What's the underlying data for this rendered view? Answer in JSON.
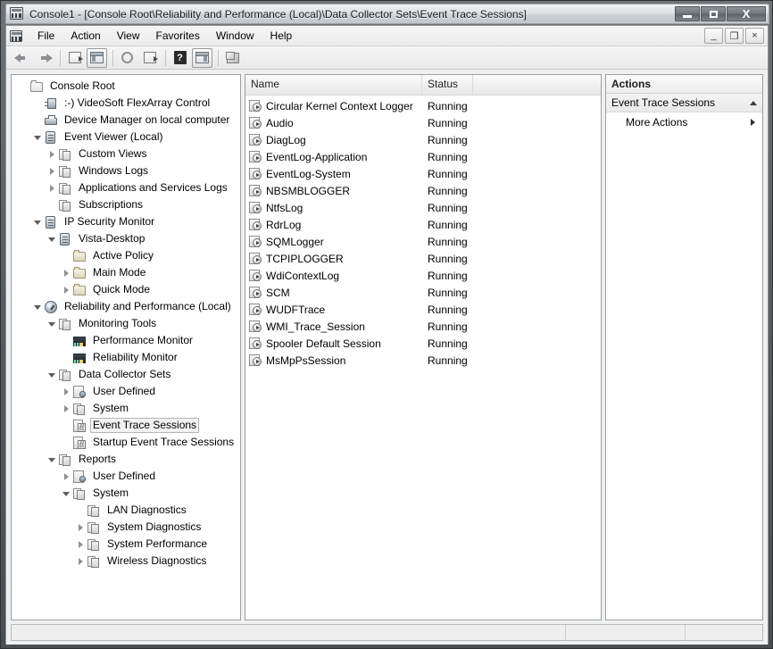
{
  "window": {
    "title": "Console1 - [Console Root\\Reliability and Performance (Local)\\Data Collector Sets\\Event Trace Sessions]",
    "title_icon": "mmc-console-icon",
    "buttons": {
      "minimize": "minimize-button",
      "maximize": "maximize-button",
      "close_label": "X"
    },
    "mdi_buttons": {
      "minimize_label": "_",
      "restore_label": "❐",
      "close_label": "×"
    }
  },
  "menu": {
    "items": [
      {
        "label": "File"
      },
      {
        "label": "Action"
      },
      {
        "label": "View"
      },
      {
        "label": "Favorites"
      },
      {
        "label": "Window"
      },
      {
        "label": "Help"
      }
    ]
  },
  "toolbar": {
    "buttons": [
      {
        "name": "back-button",
        "icon": "arrow-left-icon"
      },
      {
        "name": "forward-button",
        "icon": "arrow-right-icon"
      },
      {
        "name": "up-one-level-button",
        "icon": "folder-up-icon"
      },
      {
        "name": "show-hide-console-tree-button",
        "icon": "console-tree-icon"
      },
      {
        "name": "refresh-button",
        "icon": "refresh-icon"
      },
      {
        "name": "export-list-button",
        "icon": "export-list-icon"
      },
      {
        "name": "help-button",
        "icon": "help-icon"
      },
      {
        "name": "show-hide-action-pane-button",
        "icon": "action-pane-icon"
      },
      {
        "name": "new-window-button",
        "icon": "new-window-icon"
      }
    ]
  },
  "tree": {
    "items": [
      {
        "label": "Console Root",
        "depth": 0,
        "expander": "none",
        "icon": "root-folder-icon",
        "selected": false
      },
      {
        "label": ":-) VideoSoft FlexArray Control",
        "depth": 1,
        "expander": "none",
        "icon": "control-icon",
        "selected": false
      },
      {
        "label": "Device Manager on local computer",
        "depth": 1,
        "expander": "none",
        "icon": "device-manager-icon",
        "selected": false
      },
      {
        "label": "Event Viewer (Local)",
        "depth": 1,
        "expander": "open",
        "icon": "event-viewer-icon",
        "selected": false
      },
      {
        "label": "Custom Views",
        "depth": 2,
        "expander": "closed",
        "icon": "custom-views-icon",
        "selected": false
      },
      {
        "label": "Windows Logs",
        "depth": 2,
        "expander": "closed",
        "icon": "windows-logs-icon",
        "selected": false
      },
      {
        "label": "Applications and Services Logs",
        "depth": 2,
        "expander": "closed",
        "icon": "app-services-logs-icon",
        "selected": false
      },
      {
        "label": "Subscriptions",
        "depth": 2,
        "expander": "none",
        "icon": "subscriptions-icon",
        "selected": false
      },
      {
        "label": "IP Security Monitor",
        "depth": 1,
        "expander": "open",
        "icon": "ip-security-icon",
        "selected": false
      },
      {
        "label": "Vista-Desktop",
        "depth": 2,
        "expander": "open",
        "icon": "computer-icon",
        "selected": false
      },
      {
        "label": "Active Policy",
        "depth": 3,
        "expander": "none",
        "icon": "folder-icon",
        "selected": false
      },
      {
        "label": "Main Mode",
        "depth": 3,
        "expander": "closed",
        "icon": "folder-icon",
        "selected": false
      },
      {
        "label": "Quick Mode",
        "depth": 3,
        "expander": "closed",
        "icon": "folder-icon",
        "selected": false
      },
      {
        "label": "Reliability and Performance (Local)",
        "depth": 1,
        "expander": "open",
        "icon": "gauge-icon",
        "selected": false
      },
      {
        "label": "Monitoring Tools",
        "depth": 2,
        "expander": "open",
        "icon": "monitoring-tools-icon",
        "selected": false
      },
      {
        "label": "Performance Monitor",
        "depth": 3,
        "expander": "none",
        "icon": "performance-monitor-icon",
        "selected": false
      },
      {
        "label": "Reliability Monitor",
        "depth": 3,
        "expander": "none",
        "icon": "reliability-monitor-icon",
        "selected": false
      },
      {
        "label": "Data Collector Sets",
        "depth": 2,
        "expander": "open",
        "icon": "data-collector-sets-icon",
        "selected": false
      },
      {
        "label": "User Defined",
        "depth": 3,
        "expander": "closed",
        "icon": "user-defined-icon",
        "selected": false
      },
      {
        "label": "System",
        "depth": 3,
        "expander": "closed",
        "icon": "system-icon",
        "selected": false
      },
      {
        "label": "Event Trace Sessions",
        "depth": 3,
        "expander": "none",
        "icon": "event-trace-sessions-icon",
        "selected": true
      },
      {
        "label": "Startup Event Trace Sessions",
        "depth": 3,
        "expander": "none",
        "icon": "startup-event-trace-sessions-icon",
        "selected": false
      },
      {
        "label": "Reports",
        "depth": 2,
        "expander": "open",
        "icon": "reports-icon",
        "selected": false
      },
      {
        "label": "User Defined",
        "depth": 3,
        "expander": "closed",
        "icon": "user-defined-icon",
        "selected": false
      },
      {
        "label": "System",
        "depth": 3,
        "expander": "open",
        "icon": "system-icon",
        "selected": false
      },
      {
        "label": "LAN Diagnostics",
        "depth": 4,
        "expander": "none",
        "icon": "report-icon",
        "selected": false
      },
      {
        "label": "System Diagnostics",
        "depth": 4,
        "expander": "closed",
        "icon": "report-icon",
        "selected": false
      },
      {
        "label": "System Performance",
        "depth": 4,
        "expander": "closed",
        "icon": "report-icon",
        "selected": false
      },
      {
        "label": "Wireless Diagnostics",
        "depth": 4,
        "expander": "closed",
        "icon": "report-icon",
        "selected": false
      }
    ]
  },
  "list": {
    "columns": [
      {
        "label": "Name"
      },
      {
        "label": "Status"
      },
      {
        "label": ""
      }
    ],
    "rows": [
      {
        "name": "Circular Kernel Context Logger",
        "status": "Running"
      },
      {
        "name": "Audio",
        "status": "Running"
      },
      {
        "name": "DiagLog",
        "status": "Running"
      },
      {
        "name": "EventLog-Application",
        "status": "Running"
      },
      {
        "name": "EventLog-System",
        "status": "Running"
      },
      {
        "name": "NBSMBLOGGER",
        "status": "Running"
      },
      {
        "name": "NtfsLog",
        "status": "Running"
      },
      {
        "name": "RdrLog",
        "status": "Running"
      },
      {
        "name": "SQMLogger",
        "status": "Running"
      },
      {
        "name": "TCPIPLOGGER",
        "status": "Running"
      },
      {
        "name": "WdiContextLog",
        "status": "Running"
      },
      {
        "name": "SCM",
        "status": "Running"
      },
      {
        "name": "WUDFTrace",
        "status": "Running"
      },
      {
        "name": "WMI_Trace_Session",
        "status": "Running"
      },
      {
        "name": "Spooler Default Session",
        "status": "Running"
      },
      {
        "name": "MsMpPsSession",
        "status": "Running"
      }
    ]
  },
  "actions": {
    "title": "Actions",
    "group_label": "Event Trace Sessions",
    "items": [
      {
        "label": "More Actions"
      }
    ]
  },
  "statusbar": {
    "main": "",
    "cell_a": "",
    "cell_b": ""
  }
}
